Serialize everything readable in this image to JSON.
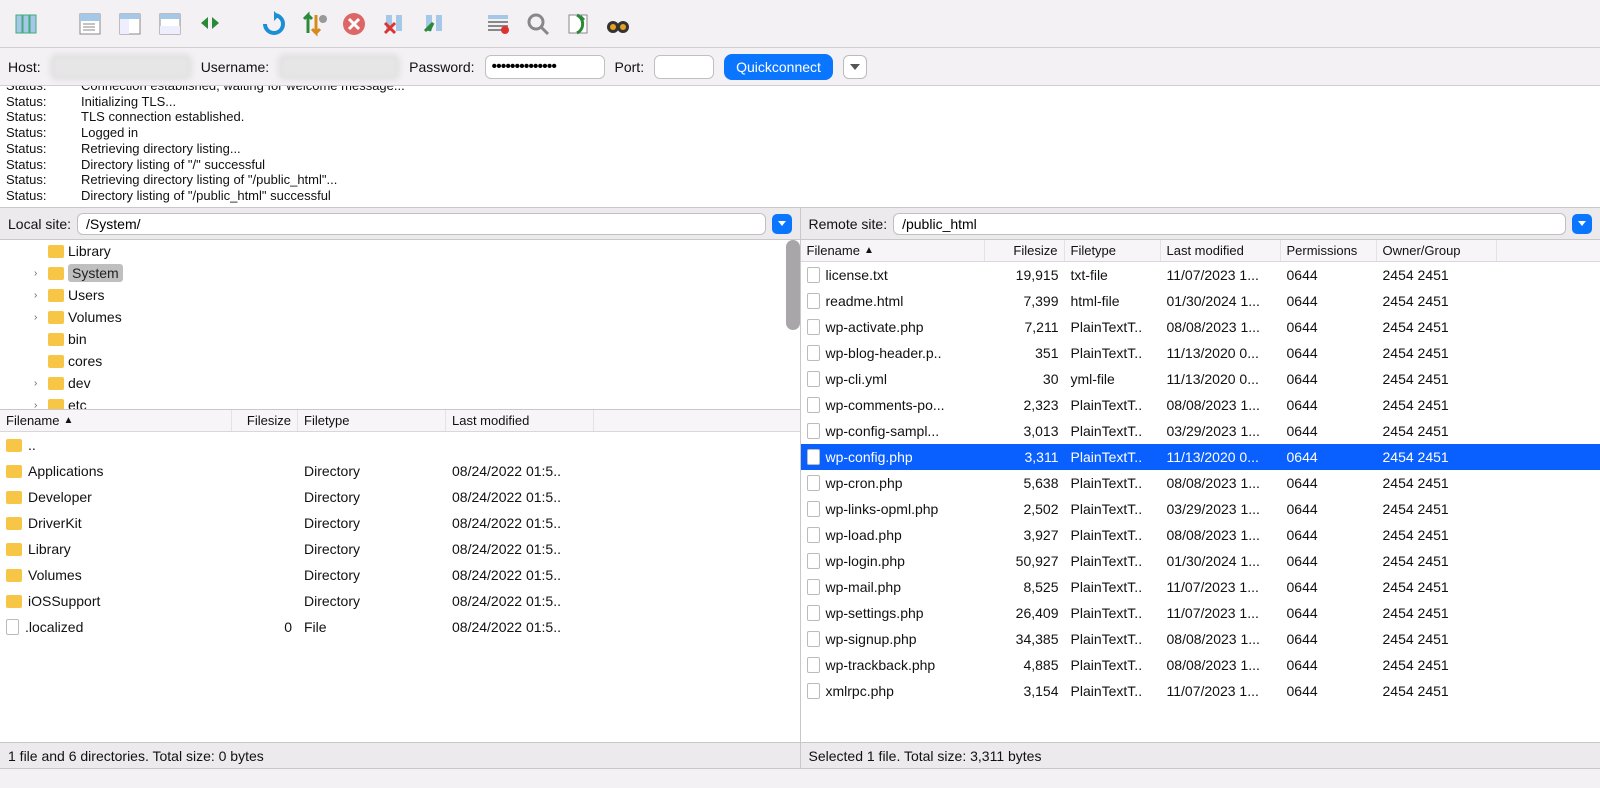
{
  "conn": {
    "host_label": "Host:",
    "user_label": "Username:",
    "pass_label": "Password:",
    "port_label": "Port:",
    "pass_value": "••••••••••••••",
    "qc_label": "Quickconnect"
  },
  "log": [
    {
      "label": "Status:",
      "msg": "Connection established, waiting for welcome message..."
    },
    {
      "label": "Status:",
      "msg": "Initializing TLS..."
    },
    {
      "label": "Status:",
      "msg": "TLS connection established."
    },
    {
      "label": "Status:",
      "msg": "Logged in"
    },
    {
      "label": "Status:",
      "msg": "Retrieving directory listing..."
    },
    {
      "label": "Status:",
      "msg": "Directory listing of \"/\" successful"
    },
    {
      "label": "Status:",
      "msg": "Retrieving directory listing of \"/public_html\"..."
    },
    {
      "label": "Status:",
      "msg": "Directory listing of \"/public_html\" successful"
    }
  ],
  "local": {
    "site_label": "Local site:",
    "path": "/System/",
    "tree": [
      {
        "indent": 1,
        "exp": "",
        "icon": "folder",
        "name": "Library",
        "sel": false
      },
      {
        "indent": 1,
        "exp": "›",
        "icon": "folder",
        "name": "System",
        "sel": true
      },
      {
        "indent": 1,
        "exp": "›",
        "icon": "folder",
        "name": "Users",
        "sel": false
      },
      {
        "indent": 1,
        "exp": "›",
        "icon": "folder",
        "name": "Volumes",
        "sel": false
      },
      {
        "indent": 1,
        "exp": "",
        "icon": "folder",
        "name": "bin",
        "sel": false
      },
      {
        "indent": 1,
        "exp": "",
        "icon": "folder",
        "name": "cores",
        "sel": false
      },
      {
        "indent": 1,
        "exp": "›",
        "icon": "folder",
        "name": "dev",
        "sel": false
      },
      {
        "indent": 1,
        "exp": "›",
        "icon": "folder",
        "name": "etc",
        "sel": false
      }
    ],
    "cols": {
      "filename": "Filename",
      "filesize": "Filesize",
      "filetype": "Filetype",
      "modified": "Last modified"
    },
    "files": [
      {
        "icon": "folder",
        "name": "..",
        "size": "",
        "type": "",
        "mod": ""
      },
      {
        "icon": "folder",
        "name": "Applications",
        "size": "",
        "type": "Directory",
        "mod": "08/24/2022 01:5.."
      },
      {
        "icon": "folder",
        "name": "Developer",
        "size": "",
        "type": "Directory",
        "mod": "08/24/2022 01:5.."
      },
      {
        "icon": "folder",
        "name": "DriverKit",
        "size": "",
        "type": "Directory",
        "mod": "08/24/2022 01:5.."
      },
      {
        "icon": "folder",
        "name": "Library",
        "size": "",
        "type": "Directory",
        "mod": "08/24/2022 01:5.."
      },
      {
        "icon": "folder",
        "name": "Volumes",
        "size": "",
        "type": "Directory",
        "mod": "08/24/2022 01:5.."
      },
      {
        "icon": "folder",
        "name": "iOSSupport",
        "size": "",
        "type": "Directory",
        "mod": "08/24/2022 01:5.."
      },
      {
        "icon": "file",
        "name": ".localized",
        "size": "0",
        "type": "File",
        "mod": "08/24/2022 01:5.."
      }
    ],
    "status": "1 file and 6 directories. Total size: 0 bytes"
  },
  "remote": {
    "site_label": "Remote site:",
    "path": "/public_html",
    "cols": {
      "filename": "Filename",
      "filesize": "Filesize",
      "filetype": "Filetype",
      "modified": "Last modified",
      "perms": "Permissions",
      "owner": "Owner/Group"
    },
    "files": [
      {
        "name": "license.txt",
        "size": "19,915",
        "type": "txt-file",
        "mod": "11/07/2023 1...",
        "perm": "0644",
        "owner": "2454 2451",
        "sel": false
      },
      {
        "name": "readme.html",
        "size": "7,399",
        "type": "html-file",
        "mod": "01/30/2024 1...",
        "perm": "0644",
        "owner": "2454 2451",
        "sel": false
      },
      {
        "name": "wp-activate.php",
        "size": "7,211",
        "type": "PlainTextT..",
        "mod": "08/08/2023 1...",
        "perm": "0644",
        "owner": "2454 2451",
        "sel": false
      },
      {
        "name": "wp-blog-header.p..",
        "size": "351",
        "type": "PlainTextT..",
        "mod": "11/13/2020 0...",
        "perm": "0644",
        "owner": "2454 2451",
        "sel": false
      },
      {
        "name": "wp-cli.yml",
        "size": "30",
        "type": "yml-file",
        "mod": "11/13/2020 0...",
        "perm": "0644",
        "owner": "2454 2451",
        "sel": false
      },
      {
        "name": "wp-comments-po...",
        "size": "2,323",
        "type": "PlainTextT..",
        "mod": "08/08/2023 1...",
        "perm": "0644",
        "owner": "2454 2451",
        "sel": false
      },
      {
        "name": "wp-config-sampl...",
        "size": "3,013",
        "type": "PlainTextT..",
        "mod": "03/29/2023 1...",
        "perm": "0644",
        "owner": "2454 2451",
        "sel": false
      },
      {
        "name": "wp-config.php",
        "size": "3,311",
        "type": "PlainTextT..",
        "mod": "11/13/2020 0...",
        "perm": "0644",
        "owner": "2454 2451",
        "sel": true
      },
      {
        "name": "wp-cron.php",
        "size": "5,638",
        "type": "PlainTextT..",
        "mod": "08/08/2023 1...",
        "perm": "0644",
        "owner": "2454 2451",
        "sel": false
      },
      {
        "name": "wp-links-opml.php",
        "size": "2,502",
        "type": "PlainTextT..",
        "mod": "03/29/2023 1...",
        "perm": "0644",
        "owner": "2454 2451",
        "sel": false
      },
      {
        "name": "wp-load.php",
        "size": "3,927",
        "type": "PlainTextT..",
        "mod": "08/08/2023 1...",
        "perm": "0644",
        "owner": "2454 2451",
        "sel": false
      },
      {
        "name": "wp-login.php",
        "size": "50,927",
        "type": "PlainTextT..",
        "mod": "01/30/2024 1...",
        "perm": "0644",
        "owner": "2454 2451",
        "sel": false
      },
      {
        "name": "wp-mail.php",
        "size": "8,525",
        "type": "PlainTextT..",
        "mod": "11/07/2023 1...",
        "perm": "0644",
        "owner": "2454 2451",
        "sel": false
      },
      {
        "name": "wp-settings.php",
        "size": "26,409",
        "type": "PlainTextT..",
        "mod": "11/07/2023 1...",
        "perm": "0644",
        "owner": "2454 2451",
        "sel": false
      },
      {
        "name": "wp-signup.php",
        "size": "34,385",
        "type": "PlainTextT..",
        "mod": "08/08/2023 1...",
        "perm": "0644",
        "owner": "2454 2451",
        "sel": false
      },
      {
        "name": "wp-trackback.php",
        "size": "4,885",
        "type": "PlainTextT..",
        "mod": "08/08/2023 1...",
        "perm": "0644",
        "owner": "2454 2451",
        "sel": false
      },
      {
        "name": "xmlrpc.php",
        "size": "3,154",
        "type": "PlainTextT..",
        "mod": "11/07/2023 1...",
        "perm": "0644",
        "owner": "2454 2451",
        "sel": false
      }
    ],
    "status": "Selected 1 file. Total size: 3,311 bytes"
  }
}
